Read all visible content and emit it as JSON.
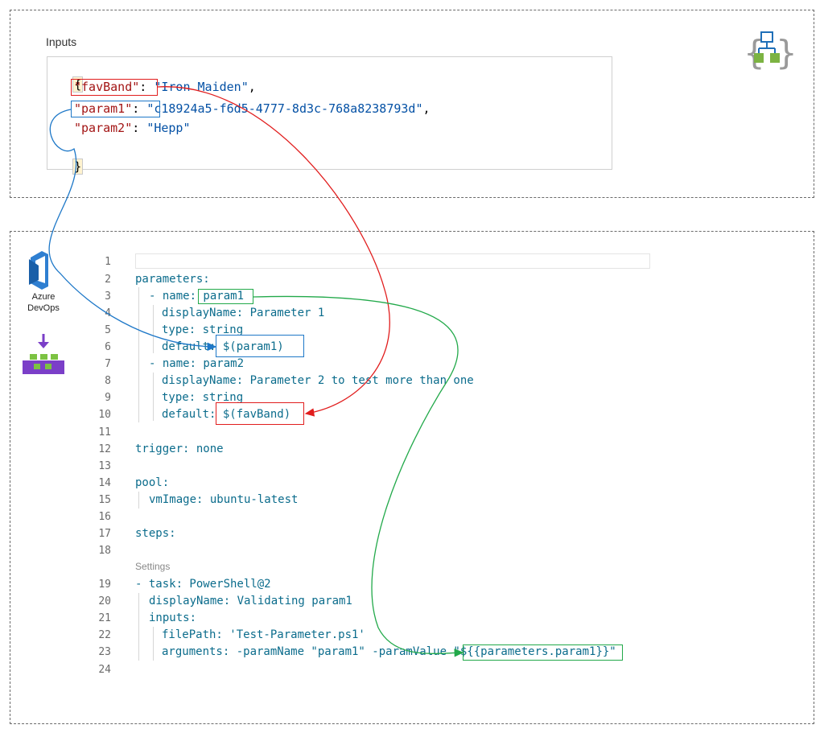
{
  "inputs": {
    "title": "Inputs",
    "lines": [
      {
        "key": "",
        "value": "",
        "text": "{"
      },
      {
        "key": "\"favBand\"",
        "value": "\"Iron Maiden\"",
        "text": ""
      },
      {
        "key": "\"param1\"",
        "value": "\"c18924a5-f6d5-4777-8d3c-768a8238793d\"",
        "text": ""
      },
      {
        "key": "\"param2\"",
        "value": "\"Hepp\"",
        "text": ""
      },
      {
        "key": "",
        "value": "",
        "text": "}"
      }
    ]
  },
  "sidebar": {
    "azure_devops_label_line1": "Azure",
    "azure_devops_label_line2": "DevOps"
  },
  "code": {
    "codelens": "Settings",
    "lines": [
      {
        "num": "1",
        "text": ""
      },
      {
        "num": "2",
        "text": "parameters:"
      },
      {
        "num": "3",
        "text": "- name: param1"
      },
      {
        "num": "4",
        "text": "displayName: Parameter 1"
      },
      {
        "num": "5",
        "text": "type: string"
      },
      {
        "num": "6",
        "text": "default: $(param1)"
      },
      {
        "num": "7",
        "text": "- name: param2"
      },
      {
        "num": "8",
        "text": "displayName: Parameter 2 to test more than one"
      },
      {
        "num": "9",
        "text": "type: string"
      },
      {
        "num": "10",
        "text": "default: $(favBand)"
      },
      {
        "num": "11",
        "text": ""
      },
      {
        "num": "12",
        "text": "trigger: none"
      },
      {
        "num": "13",
        "text": ""
      },
      {
        "num": "14",
        "text": "pool:"
      },
      {
        "num": "15",
        "text": "vmImage: ubuntu-latest"
      },
      {
        "num": "16",
        "text": ""
      },
      {
        "num": "17",
        "text": "steps:"
      },
      {
        "num": "18",
        "text": ""
      },
      {
        "num": "19",
        "text": "- task: PowerShell@2"
      },
      {
        "num": "20",
        "text": "displayName: Validating param1"
      },
      {
        "num": "21",
        "text": "inputs:"
      },
      {
        "num": "22",
        "text": "filePath: 'Test-Parameter.ps1'"
      },
      {
        "num": "23",
        "text": "arguments: -paramName \"param1\" -paramValue \"${{parameters.param1}}\""
      },
      {
        "num": "24",
        "text": ""
      }
    ]
  },
  "colors": {
    "red_arrow": "#e11d1d",
    "blue_arrow": "#1e78c8",
    "green_arrow": "#22a94a",
    "json_key": "#a31515",
    "json_value": "#0451a5",
    "yaml_key": "#0b6c8c"
  },
  "icons": [
    "logic-app-icon",
    "azure-devops-icon",
    "azure-artifacts-icon"
  ]
}
